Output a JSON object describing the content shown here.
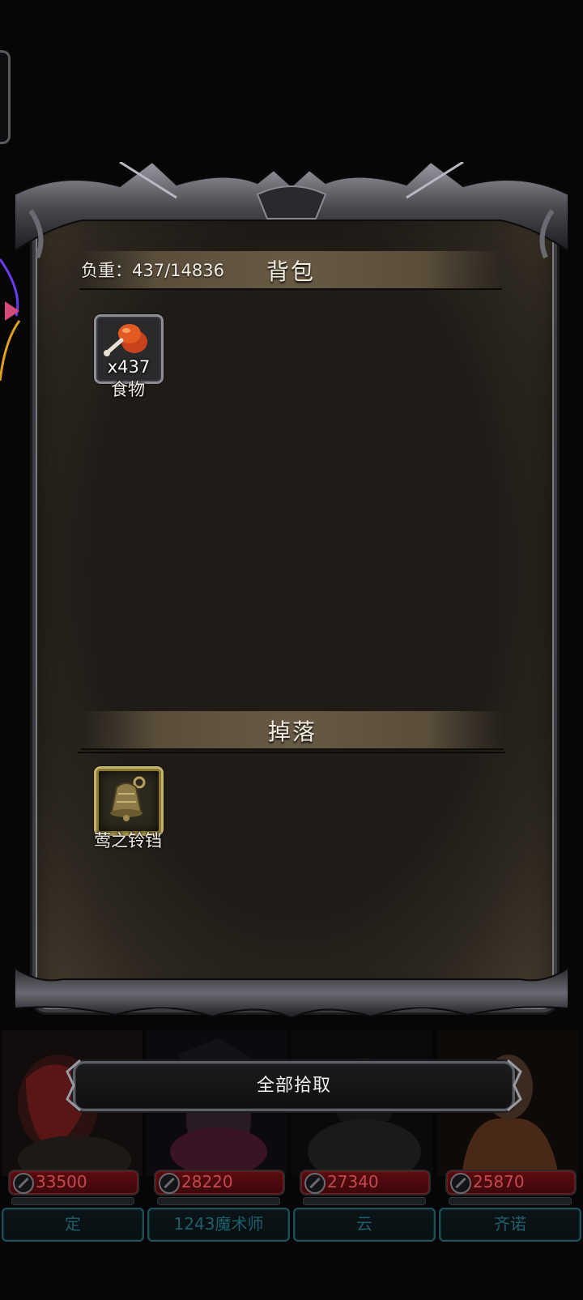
{
  "bag": {
    "weight_label": "负重：437/14836",
    "title": "背包",
    "items": [
      {
        "count": "x437",
        "name": "食物",
        "icon": "roast-chicken-icon"
      }
    ]
  },
  "drops": {
    "title": "掉落",
    "items": [
      {
        "name": "莺之铃铛",
        "icon": "bell-icon"
      }
    ]
  },
  "pickup_all_label": "全部拾取",
  "heroes": [
    {
      "hp": "33500",
      "name": "定"
    },
    {
      "hp": "28220",
      "name": "1243魔术师"
    },
    {
      "hp": "27340",
      "name": "云"
    },
    {
      "hp": "25870",
      "name": "齐诺"
    }
  ],
  "colors": {
    "hp_text": "#c04a4f",
    "name_plate_text": "#1f5f6c",
    "gold_slot_border": "#c7b46a"
  }
}
